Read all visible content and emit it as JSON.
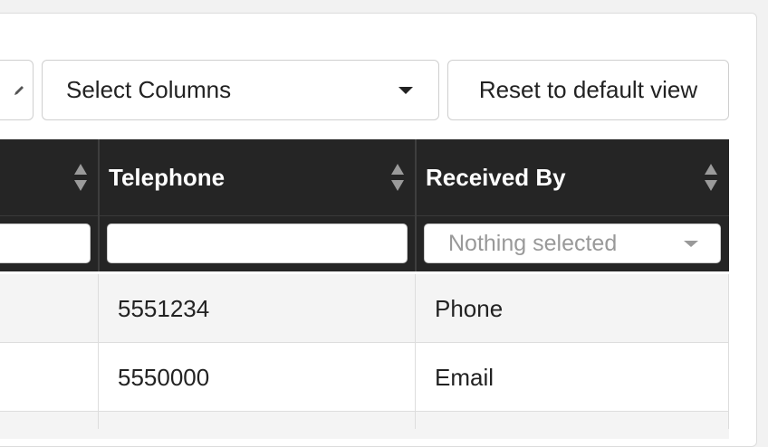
{
  "toolbar": {
    "select_columns_label": "Select Columns",
    "reset_label": "Reset to default view"
  },
  "table": {
    "columns": [
      {
        "label": ""
      },
      {
        "label": "Telephone"
      },
      {
        "label": "Received By"
      }
    ],
    "filters": {
      "received_by_placeholder": "Nothing selected"
    },
    "rows": [
      {
        "telephone": "5551234",
        "received_by": "Phone"
      },
      {
        "telephone": "5550000",
        "received_by": "Email"
      }
    ]
  },
  "colors": {
    "header_bg": "#252525",
    "row_stripe": "#f4f4f4",
    "border": "#dddddd"
  }
}
